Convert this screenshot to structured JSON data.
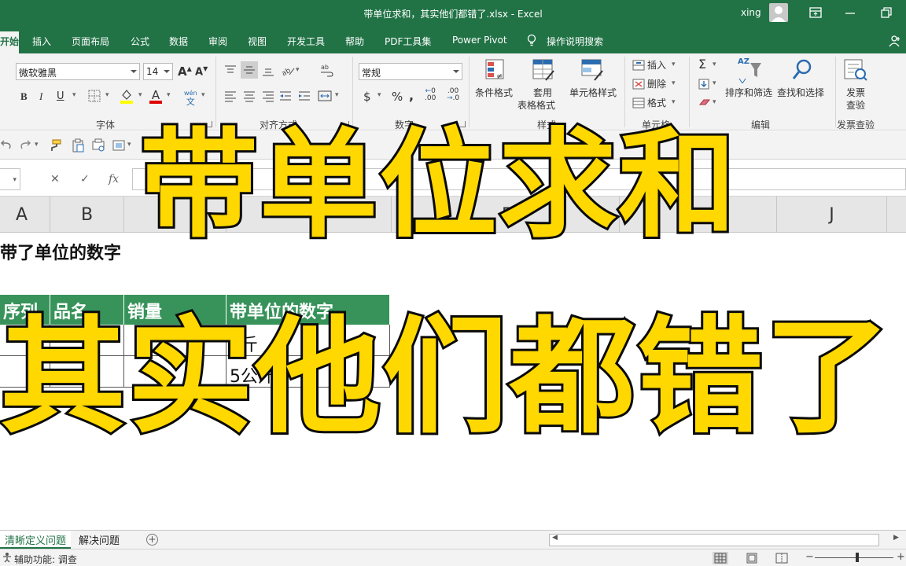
{
  "window": {
    "title": "带单位求和，其实他们都错了.xlsx  -  Excel",
    "user": "xing"
  },
  "tabs": [
    "开始",
    "插入",
    "页面布局",
    "公式",
    "数据",
    "审阅",
    "视图",
    "开发工具",
    "帮助",
    "PDF工具集",
    "Power Pivot",
    "操作说明搜索"
  ],
  "ribbon": {
    "font_name": "微软雅黑",
    "font_size": "14",
    "number_format": "常规",
    "group_font": "字体",
    "group_align": "对齐方式",
    "group_number": "数字",
    "group_styles": "样式",
    "group_cells": "单元格",
    "group_edit": "编辑",
    "group_invoice": "发票查验",
    "btn_cond_format": "条件格式",
    "btn_table_format_1": "套用",
    "btn_table_format_2": "表格格式",
    "btn_cell_style": "单元格样式",
    "btn_insert": "插入",
    "btn_delete": "删除",
    "btn_format": "格式",
    "btn_sort_filter": "排序和筛选",
    "btn_find_select": "查找和选择",
    "btn_invoice_1": "发票",
    "btn_invoice_2": "查验",
    "bold": "B",
    "italic": "I",
    "underline": "U",
    "font_color": "A",
    "wen": "文",
    "currency": "$",
    "percent": "%",
    "comma": ",",
    "inc_dec": ".00",
    "dec_dec": ".0",
    "sigma": "Σ",
    "az": "AZ"
  },
  "formula_bar": {
    "fx": "fx"
  },
  "columns": [
    "A",
    "B",
    "F",
    "J"
  ],
  "grid": {
    "a1": "带了单位的数字",
    "headers": [
      "序列",
      "品名",
      "销量",
      "带单位的数字"
    ],
    "rows": [
      {
        "d": "5斤"
      },
      {
        "d": "5公斤"
      }
    ]
  },
  "overlay": {
    "headline1": "带单位求和",
    "headline2": "其实他们都错了"
  },
  "sheets": [
    "清晰定义问题",
    "解决问题"
  ],
  "status": {
    "accessibility": "辅助功能: 调查"
  },
  "colors": {
    "brand": "#217346",
    "table_header": "#37935a",
    "headline_fill": "#ffd800",
    "headline_stroke": "#0a0a0a"
  }
}
